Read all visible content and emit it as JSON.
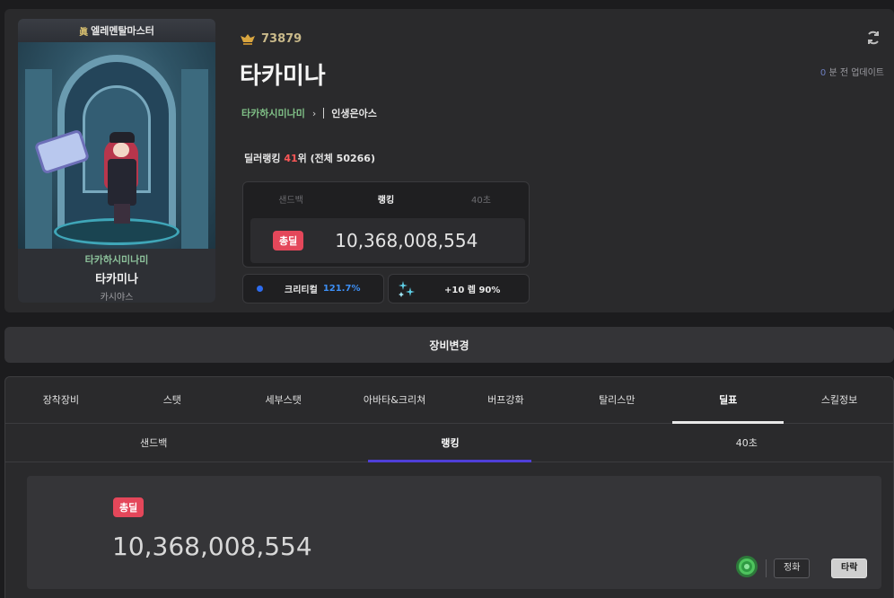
{
  "character": {
    "banner_title": "엘레멘탈마스터",
    "guild": "타카하시미나미",
    "name": "타카미나",
    "server": "카시야스",
    "level": "73879",
    "adventure_name": "인생은아스"
  },
  "ranking": {
    "prefix": "딜러랭킹 ",
    "rank": "41",
    "suffix": "위 (전체 50266)"
  },
  "damage_box": {
    "tabs": [
      "샌드백",
      "랭킹",
      "40초"
    ],
    "active_tab": 1,
    "badge": "총딜",
    "value": "10,368,008,554"
  },
  "stats": {
    "crit_label": "크리티컬",
    "crit_value": "121.7%",
    "enhance_label": "+10 렙 90%"
  },
  "update": {
    "count": "0",
    "text": "분 전 업데이트"
  },
  "equip_change_label": "장비변경",
  "main_tabs": [
    "장착장비",
    "스탯",
    "세부스탯",
    "아바타&크리쳐",
    "버프강화",
    "탈리스만",
    "딜표",
    "스킬정보"
  ],
  "main_active_tab": 6,
  "sub_tabs": [
    "샌드백",
    "랭킹",
    "40초"
  ],
  "sub_active_tab": 1,
  "result": {
    "badge": "총딜",
    "value": "10,368,008,554",
    "option_1": "정화",
    "option_2": "타락"
  },
  "colors": {
    "accent_red": "#e4475a",
    "accent_purple": "#4f3fd8",
    "guild_green": "#7fbf86",
    "crit_blue": "#3d8ff5"
  },
  "icons": [
    "crest-icon",
    "refresh-icon",
    "chevron-right-icon",
    "dot-icon",
    "sparkle-icon",
    "flower-icon"
  ]
}
